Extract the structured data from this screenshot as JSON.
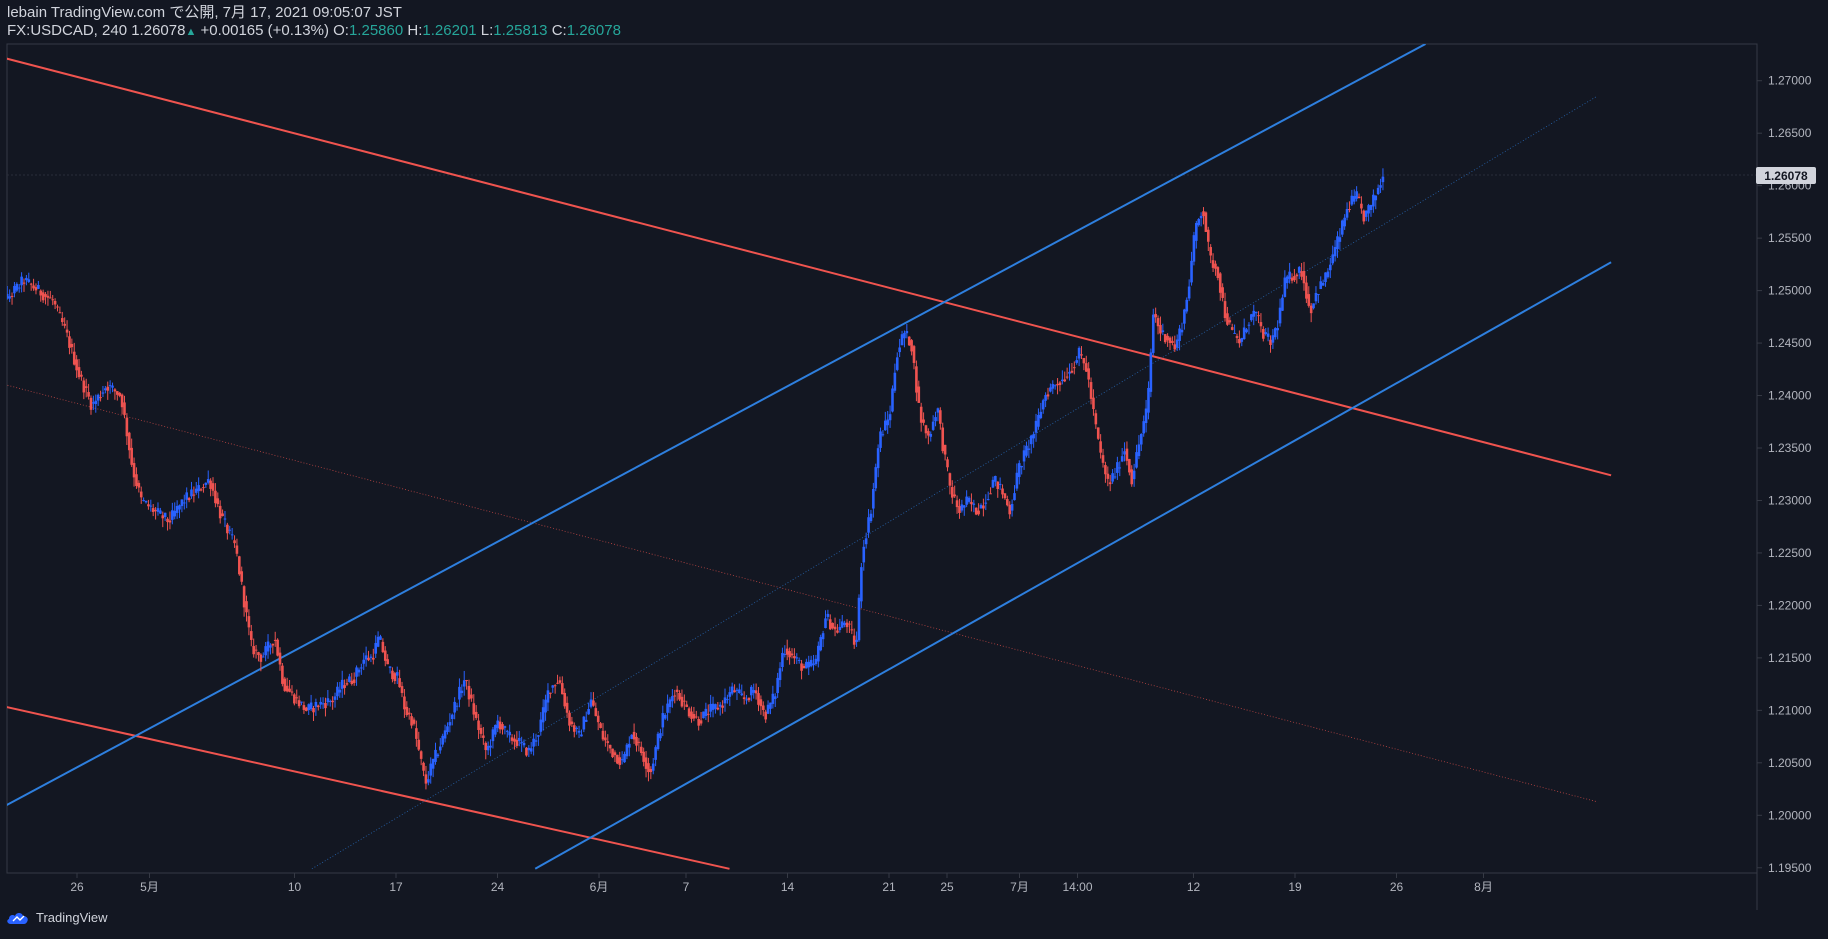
{
  "header": {
    "published": "lebain TradingView.com で公開, 7月 17, 2021 09:05:07 JST",
    "symbol": "FX:USDCAD, 240",
    "last": "1.26078",
    "change": "+0.00165 (+0.13%)",
    "o_label": "O:",
    "o_value": "1.25860",
    "h_label": "H:",
    "h_value": "1.26201",
    "l_label": "L:",
    "l_value": "1.25813",
    "c_label": "C:",
    "c_value": "1.26078"
  },
  "footer": {
    "brand": "TradingView"
  },
  "colors": {
    "background": "#131722",
    "up": "#2962ff",
    "down": "#ef5350",
    "channel_up": "#2e7fde",
    "channel_down": "#f0544f",
    "axis_text": "#b2b5be",
    "grid_border": "#363a45"
  },
  "chart_data": {
    "type": "candlestick",
    "symbol": "FX:USDCAD",
    "timeframe": "240",
    "grid": false,
    "y_range": [
      1.1945,
      1.2735
    ],
    "last_price": "1.26078",
    "y_ticks": [
      "1.27000",
      "1.26500",
      "1.26000",
      "1.25500",
      "1.25000",
      "1.24500",
      "1.24000",
      "1.23500",
      "1.23000",
      "1.22500",
      "1.22000",
      "1.21500",
      "1.21000",
      "1.20500",
      "1.20000",
      "1.19500"
    ],
    "x_ticks": [
      {
        "label": "26",
        "day": 26
      },
      {
        "label": "5月",
        "day": 31
      },
      {
        "label": "10",
        "day": 41
      },
      {
        "label": "17",
        "day": 48
      },
      {
        "label": "24",
        "day": 55
      },
      {
        "label": "6月",
        "day": 62
      },
      {
        "label": "7",
        "day": 68
      },
      {
        "label": "14",
        "day": 75
      },
      {
        "label": "21",
        "day": 82
      },
      {
        "label": "25",
        "day": 86
      },
      {
        "label": "7月",
        "day": 91
      },
      {
        "label": "14:00",
        "day": 95
      },
      {
        "label": "12",
        "day": 103
      },
      {
        "label": "19",
        "day": 110
      },
      {
        "label": "26",
        "day": 117
      },
      {
        "label": "8月",
        "day": 123
      }
    ],
    "x_axis_note": "day = days after 2021-03-31",
    "price_path": [
      [
        20.2,
        1.261
      ],
      [
        20.6,
        1.2625
      ],
      [
        21.2,
        1.249
      ],
      [
        22.5,
        1.251
      ],
      [
        23.5,
        1.25
      ],
      [
        24.5,
        1.249
      ],
      [
        25.4,
        1.246
      ],
      [
        26.3,
        1.242
      ],
      [
        27.2,
        1.239
      ],
      [
        28.2,
        1.241
      ],
      [
        29.2,
        1.24
      ],
      [
        30.0,
        1.233
      ],
      [
        30.6,
        1.23
      ],
      [
        31.5,
        1.229
      ],
      [
        32.5,
        1.228
      ],
      [
        33.5,
        1.23
      ],
      [
        34.5,
        1.231
      ],
      [
        35.3,
        1.232
      ],
      [
        36.1,
        1.2285
      ],
      [
        37.1,
        1.2255
      ],
      [
        38.2,
        1.216
      ],
      [
        38.9,
        1.215
      ],
      [
        39.8,
        1.217
      ],
      [
        40.4,
        1.2125
      ],
      [
        41.3,
        1.211
      ],
      [
        42.0,
        1.21
      ],
      [
        42.7,
        1.2105
      ],
      [
        43.8,
        1.211
      ],
      [
        44.5,
        1.2125
      ],
      [
        45.2,
        1.213
      ],
      [
        46.0,
        1.215
      ],
      [
        46.5,
        1.215
      ],
      [
        47.0,
        1.217
      ],
      [
        47.6,
        1.214
      ],
      [
        48.3,
        1.213
      ],
      [
        48.8,
        1.21
      ],
      [
        49.3,
        1.209
      ],
      [
        49.9,
        1.205
      ],
      [
        50.2,
        1.203
      ],
      [
        50.7,
        1.205
      ],
      [
        51.3,
        1.207
      ],
      [
        52.1,
        1.21
      ],
      [
        52.9,
        1.213
      ],
      [
        53.7,
        1.209
      ],
      [
        54.4,
        1.206
      ],
      [
        55.2,
        1.209
      ],
      [
        55.9,
        1.2075
      ],
      [
        56.6,
        1.207
      ],
      [
        57.3,
        1.206
      ],
      [
        58.0,
        1.208
      ],
      [
        58.7,
        1.212
      ],
      [
        59.4,
        1.213
      ],
      [
        60.1,
        1.209
      ],
      [
        60.8,
        1.2075
      ],
      [
        61.6,
        1.211
      ],
      [
        62.4,
        1.2075
      ],
      [
        63.1,
        1.206
      ],
      [
        63.8,
        1.205
      ],
      [
        64.4,
        1.208
      ],
      [
        65.1,
        1.206
      ],
      [
        65.7,
        1.204
      ],
      [
        66.5,
        1.209
      ],
      [
        67.4,
        1.212
      ],
      [
        68.3,
        1.21
      ],
      [
        69.0,
        1.209
      ],
      [
        69.8,
        1.21
      ],
      [
        70.6,
        1.2105
      ],
      [
        71.4,
        1.212
      ],
      [
        72.2,
        1.211
      ],
      [
        72.9,
        1.212
      ],
      [
        73.6,
        1.2095
      ],
      [
        74.3,
        1.2115
      ],
      [
        74.9,
        1.216
      ],
      [
        75.6,
        1.215
      ],
      [
        76.3,
        1.214
      ],
      [
        77.1,
        1.2145
      ],
      [
        77.8,
        1.219
      ],
      [
        78.5,
        1.2175
      ],
      [
        79.2,
        1.2185
      ],
      [
        79.5,
        1.2175
      ],
      [
        79.9,
        1.216
      ],
      [
        80.3,
        1.225
      ],
      [
        80.9,
        1.229
      ],
      [
        81.5,
        1.236
      ],
      [
        82.2,
        1.238
      ],
      [
        82.7,
        1.244
      ],
      [
        83.2,
        1.246
      ],
      [
        83.7,
        1.245
      ],
      [
        84.3,
        1.238
      ],
      [
        84.9,
        1.236
      ],
      [
        85.5,
        1.239
      ],
      [
        85.9,
        1.235
      ],
      [
        86.4,
        1.231
      ],
      [
        87.0,
        1.229
      ],
      [
        87.6,
        1.23
      ],
      [
        88.2,
        1.229
      ],
      [
        88.8,
        1.23
      ],
      [
        89.4,
        1.232
      ],
      [
        89.9,
        1.231
      ],
      [
        90.5,
        1.229
      ],
      [
        91.1,
        1.233
      ],
      [
        91.7,
        1.235
      ],
      [
        92.3,
        1.237
      ],
      [
        92.9,
        1.24
      ],
      [
        93.5,
        1.241
      ],
      [
        94.1,
        1.2415
      ],
      [
        94.7,
        1.2425
      ],
      [
        95.3,
        1.244
      ],
      [
        95.8,
        1.2425
      ],
      [
        96.3,
        1.238
      ],
      [
        96.8,
        1.234
      ],
      [
        97.3,
        1.2315
      ],
      [
        97.9,
        1.233
      ],
      [
        98.4,
        1.235
      ],
      [
        98.9,
        1.232
      ],
      [
        99.5,
        1.236
      ],
      [
        100.0,
        1.239
      ],
      [
        100.4,
        1.248
      ],
      [
        100.9,
        1.246
      ],
      [
        101.4,
        1.2455
      ],
      [
        101.9,
        1.2445
      ],
      [
        102.4,
        1.247
      ],
      [
        102.8,
        1.25
      ],
      [
        103.3,
        1.256
      ],
      [
        103.8,
        1.258
      ],
      [
        104.3,
        1.253
      ],
      [
        104.8,
        1.252
      ],
      [
        105.3,
        1.248
      ],
      [
        105.8,
        1.246
      ],
      [
        106.4,
        1.245
      ],
      [
        106.9,
        1.247
      ],
      [
        107.4,
        1.248
      ],
      [
        107.9,
        1.246
      ],
      [
        108.5,
        1.245
      ],
      [
        109.0,
        1.247
      ],
      [
        109.5,
        1.251
      ],
      [
        110.1,
        1.2515
      ],
      [
        110.6,
        1.252
      ],
      [
        111.2,
        1.248
      ],
      [
        111.7,
        1.25
      ],
      [
        112.2,
        1.251
      ],
      [
        112.7,
        1.253
      ],
      [
        113.3,
        1.2555
      ],
      [
        113.8,
        1.258
      ],
      [
        114.4,
        1.259
      ],
      [
        114.9,
        1.257
      ],
      [
        115.4,
        1.258
      ],
      [
        115.9,
        1.2598
      ],
      [
        116.2,
        1.26078
      ]
    ],
    "candle_up": [
      13,
      19,
      20,
      26,
      30,
      38,
      44,
      49,
      51,
      54,
      61,
      64,
      67,
      69,
      75,
      79,
      83,
      88,
      94,
      98,
      105,
      106,
      111,
      117,
      121,
      125,
      126,
      129,
      133,
      134,
      136
    ],
    "lines": [
      {
        "name": "upper-red",
        "color": "#f0544f",
        "style": "solid",
        "points": [
          [
            17.0,
            1.2736
          ],
          [
            131.8,
            1.2324
          ]
        ]
      },
      {
        "name": "lower-red",
        "color": "#f0544f",
        "style": "solid",
        "points": [
          [
            17.0,
            1.2116
          ],
          [
            71.0,
            1.1949
          ]
        ]
      },
      {
        "name": "mid-red",
        "color": "#f0544f",
        "style": "dotted",
        "points": [
          [
            17.0,
            1.2425
          ],
          [
            130.8,
            1.2013
          ]
        ]
      },
      {
        "name": "upper-blue",
        "color": "#2e7fde",
        "style": "solid",
        "points": [
          [
            17.0,
            1.1979
          ],
          [
            119.0,
            1.2735
          ]
        ]
      },
      {
        "name": "lower-blue",
        "color": "#2e7fde",
        "style": "solid",
        "points": [
          [
            57.6,
            1.1949
          ],
          [
            131.8,
            1.2527
          ]
        ]
      },
      {
        "name": "mid-blue",
        "color": "#2e7fde",
        "style": "dotted",
        "points": [
          [
            42.2,
            1.1949
          ],
          [
            130.8,
            1.2685
          ]
        ]
      }
    ]
  }
}
